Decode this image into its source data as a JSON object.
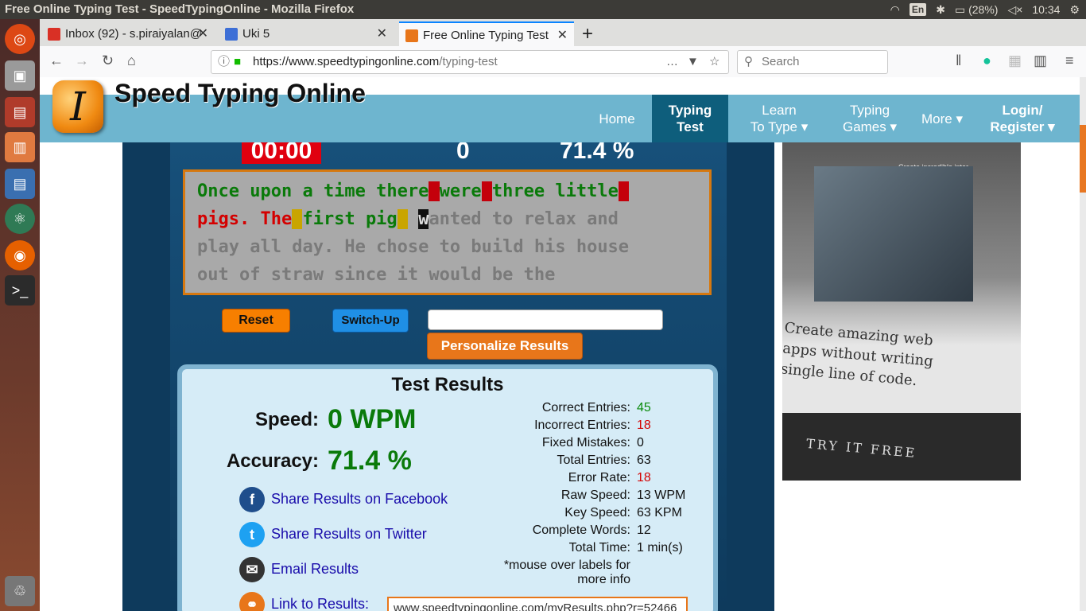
{
  "os": {
    "window_title": "Free Online Typing Test - SpeedTypingOnline - Mozilla Firefox",
    "keyboard": "En",
    "battery": "(28%)",
    "time": "10:34"
  },
  "browser": {
    "tabs": [
      {
        "label": "Inbox (92) - s.piraiyalan@",
        "icon_color": "#d93025"
      },
      {
        "label": "Uki 5",
        "icon_color": "#3d6fd6"
      },
      {
        "label": "Free Online Typing Test",
        "icon_color": "#e8761a"
      }
    ],
    "new_tab": "+",
    "url_host": "https://www.speedtypingonline.com",
    "url_path": "/typing-test",
    "search_placeholder": "Search"
  },
  "site": {
    "name": "Speed Typing Online",
    "logo_letter": "I",
    "nav": [
      {
        "l1": "Home",
        "l2": ""
      },
      {
        "l1": "Typing",
        "l2": "Test"
      },
      {
        "l1": "Learn",
        "l2": "To Type ▾"
      },
      {
        "l1": "Typing",
        "l2": "Games ▾"
      },
      {
        "l1": "More ▾",
        "l2": ""
      },
      {
        "l1": "Login/",
        "l2": "Register ▾"
      }
    ]
  },
  "test": {
    "timer": "00:00",
    "wpm": "0",
    "accuracy": "71.4 %",
    "buttons": {
      "reset": "Reset",
      "switch": "Switch-Up",
      "personalize": "Personalize Results"
    },
    "text_lines": [
      [
        {
          "t": "Once upon a time there",
          "c": "ok"
        },
        {
          "t": " ",
          "c": "err"
        },
        {
          "t": "were",
          "c": "ok"
        },
        {
          "t": " ",
          "c": "err"
        },
        {
          "t": "three little",
          "c": "ok"
        },
        {
          "t": " ",
          "c": "err"
        }
      ],
      [
        {
          "t": "pigs. The",
          "c": "ok2"
        },
        {
          "t": " ",
          "c": "fix"
        },
        {
          "t": "first pig",
          "c": "ok"
        },
        {
          "t": " ",
          "c": "fix"
        },
        {
          "t": " ",
          "c": "plain"
        },
        {
          "t": "w",
          "c": "cur"
        },
        {
          "t": "anted to relax and",
          "c": "todo"
        }
      ],
      [
        {
          "t": "play all day. He chose to build his house",
          "c": "todo"
        }
      ],
      [
        {
          "t": "out of straw since it would be the",
          "c": "todo"
        }
      ]
    ]
  },
  "results": {
    "title": "Test Results",
    "speed_label": "Speed:",
    "speed_value": "0 WPM",
    "accuracy_label": "Accuracy:",
    "accuracy_value": "71.4 %",
    "share": [
      {
        "label": "Share Results on Facebook",
        "icon": "f",
        "color": "#1f4e8c"
      },
      {
        "label": "Share Results on Twitter",
        "icon": "t",
        "color": "#1da1f2"
      },
      {
        "label": "Email Results",
        "icon": "✉",
        "color": "#333333"
      },
      {
        "label": "Link to Results:",
        "icon": "⚭",
        "color": "#e8761a"
      }
    ],
    "rows": [
      {
        "label": "Correct Entries:",
        "value": "45",
        "color": "#0a8a0a"
      },
      {
        "label": "Incorrect Entries:",
        "value": "18",
        "color": "#d40000"
      },
      {
        "label": "Fixed Mistakes:",
        "value": "0",
        "color": "#111111"
      },
      {
        "label": "Total Entries:",
        "value": "63",
        "color": "#111111"
      },
      {
        "label": "Error Rate:",
        "value": "18",
        "color": "#d40000"
      },
      {
        "label": "Raw Speed:",
        "value": "13 WPM",
        "color": "#111111"
      },
      {
        "label": "Key Speed:",
        "value": "63 KPM",
        "color": "#111111"
      },
      {
        "label": "Complete Words:",
        "value": "12",
        "color": "#111111"
      },
      {
        "label": "Total Time:",
        "value": "1 min(s)",
        "color": "#111111"
      }
    ],
    "note_line1": "*mouse over labels for",
    "note_line2": "more info",
    "link_value": "www.speedtypingonline.com/myResults.php?r=52466"
  },
  "ad": {
    "small_text": "Create incredible inter",
    "headline": "Create amazing web apps without writing single line of code.",
    "cta": "TRY IT FREE"
  },
  "colors": {
    "accent": "#e8761a",
    "header": "#6eb5cf",
    "correct": "#0a8a0a",
    "error": "#d40000"
  }
}
